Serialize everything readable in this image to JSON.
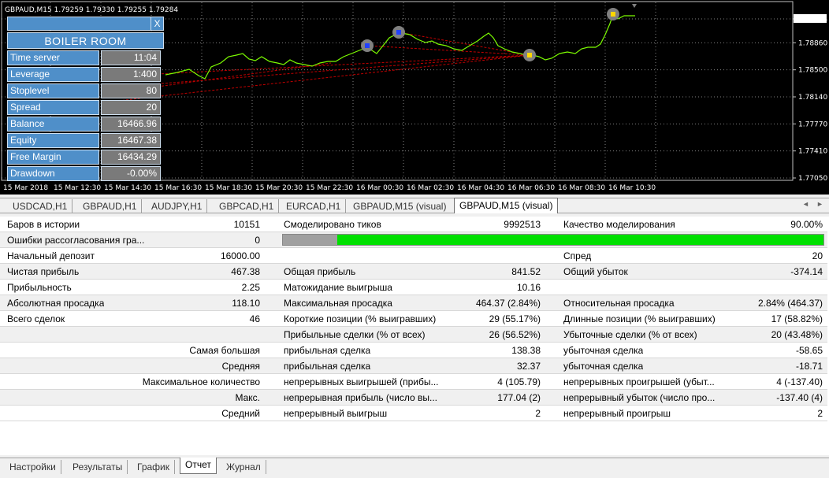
{
  "chart": {
    "header": "GBPAUD,M15  1.79259 1.79330 1.79255 1.79284",
    "current_price": "1.79284",
    "price_levels": [
      "1.79284",
      "1.78860",
      "1.78500",
      "1.78140",
      "1.77770",
      "1.77410",
      "1.77050"
    ],
    "time_labels": [
      "15 Mar 2018",
      "15 Mar 12:30",
      "15 Mar 14:30",
      "15 Mar 16:30",
      "15 Mar 18:30",
      "15 Mar 20:30",
      "15 Mar 22:30",
      "16 Mar 00:30",
      "16 Mar 02:30",
      "16 Mar 04:30",
      "16 Mar 06:30",
      "16 Mar 08:30",
      "16 Mar 10:30"
    ],
    "line_color": "#7cfc00",
    "grid_color": "#808080"
  },
  "panel": {
    "close_label": "X",
    "title": "BOILER ROOM",
    "rows": [
      {
        "label": "Time server",
        "value": "11:04"
      },
      {
        "label": "Leverage",
        "value": "1:400"
      },
      {
        "label": "Stoplevel",
        "value": "80"
      },
      {
        "label": "Spread",
        "value": "20"
      },
      {
        "label": "Balance",
        "value": "16466.96"
      },
      {
        "label": "Equity",
        "value": "16467.38"
      },
      {
        "label": "Free Margin",
        "value": "16434.29"
      },
      {
        "label": "Drawdown",
        "value": "-0.00%"
      }
    ]
  },
  "symbol_tabs": [
    {
      "label": "USDCAD,H1"
    },
    {
      "label": "GBPAUD,H1"
    },
    {
      "label": "AUDJPY,H1"
    },
    {
      "label": "GBPCAD,H1"
    },
    {
      "label": "EURCAD,H1"
    },
    {
      "label": "GBPAUD,M15 (visual)"
    },
    {
      "label": "GBPAUD,M15 (visual)"
    }
  ],
  "tab_nav": {
    "left": "◄",
    "right": "►"
  },
  "report": {
    "r1": {
      "bars_label": "Баров в истории",
      "bars_value": "10151",
      "ticks_label": "Смоделировано тиков",
      "ticks_value": "9992513",
      "quality_label": "Качество моделирования",
      "quality_value": "90.00%"
    },
    "r2": {
      "label": "Ошибки рассогласования гра...",
      "value": "0",
      "quality_fraction": 0.9
    },
    "r3": {
      "label": "Начальный депозит",
      "value": "16000.00",
      "spread_label": "Спред",
      "spread_value": "20"
    },
    "r4": {
      "l1": "Чистая прибыль",
      "v1": "467.38",
      "l2": "Общая прибыль",
      "v2": "841.52",
      "l3": "Общий убыток",
      "v3": "-374.14"
    },
    "r5": {
      "l1": "Прибыльность",
      "v1": "2.25",
      "l2": "Матожидание выигрыша",
      "v2": "10.16"
    },
    "r6": {
      "l1": "Абсолютная просадка",
      "v1": "118.10",
      "l2": "Максимальная просадка",
      "v2": "464.37 (2.84%)",
      "l3": "Относительная просадка",
      "v3": "2.84% (464.37)"
    },
    "r7": {
      "l1": "Всего сделок",
      "v1": "46",
      "l2": "Короткие позиции (% выигравших)",
      "v2": "29 (55.17%)",
      "l3": "Длинные позиции (% выигравших)",
      "v3": "17 (58.82%)"
    },
    "r8": {
      "l2": "Прибыльные сделки (% от всех)",
      "v2": "26 (56.52%)",
      "l3": "Убыточные сделки (% от всех)",
      "v3": "20 (43.48%)"
    },
    "r9": {
      "l1": "Самая большая",
      "l2": "прибыльная сделка",
      "v2": "138.38",
      "l3": "убыточная сделка",
      "v3": "-58.65"
    },
    "r10": {
      "l1": "Средняя",
      "l2": "прибыльная сделка",
      "v2": "32.37",
      "l3": "убыточная сделка",
      "v3": "-18.71"
    },
    "r11": {
      "l1": "Максимальное количество",
      "l2": "непрерывных выигрышей (прибы...",
      "v2": "4 (105.79)",
      "l3": "непрерывных проигрышей (убыт...",
      "v3": "4 (-137.40)"
    },
    "r12": {
      "l1": "Макс.",
      "l2": "непрерывная прибыль (число вы...",
      "v2": "177.04 (2)",
      "l3": "непрерывный убыток (число про...",
      "v3": "-137.40 (4)"
    },
    "r13": {
      "l1": "Средний",
      "l2": "непрерывный выигрыш",
      "v2": "2",
      "l3": "непрерывный проигрыш",
      "v3": "2"
    }
  },
  "bottom_tabs": [
    {
      "label": "Настройки"
    },
    {
      "label": "Результаты"
    },
    {
      "label": "График"
    },
    {
      "label": "Отчет"
    },
    {
      "label": "Журнал"
    }
  ]
}
